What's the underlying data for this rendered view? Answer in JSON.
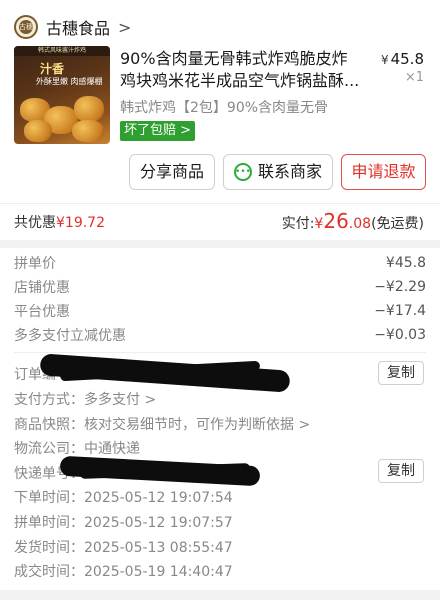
{
  "store": {
    "name": "古穗食品",
    "chevron": ">",
    "logo_text": "古穗"
  },
  "product": {
    "image_strip_text": "韩式风味酱汁炸鸡",
    "image_title": "汁香",
    "image_subtitle": "外酥里嫩 肉感爆棚",
    "title_line1": "90%含肉量无骨韩式炸鸡脆皮炸",
    "title_line2": "鸡块鸡米花半成品空气炸锅盐酥...",
    "price_symbol": "¥",
    "price": "45.8",
    "quantity": "×1",
    "spec": "韩式炸鸡【2包】90%含肉量无骨",
    "badge": "坏了包赔 >"
  },
  "actions": {
    "share": "分享商品",
    "contact": "联系商家",
    "refund": "申请退款"
  },
  "summary": {
    "discount_label": "共优惠",
    "discount_value": "¥19.72",
    "paid_label": "实付: ",
    "paid_symbol": "¥ ",
    "paid_int": "26",
    "paid_dec": ".08",
    "paid_note": " (免运费)"
  },
  "details": [
    {
      "label": "拼单价",
      "value": "¥45.8"
    },
    {
      "label": "店铺优惠",
      "value": "−¥2.29"
    },
    {
      "label": "平台优惠",
      "value": "−¥17.4"
    },
    {
      "label": "多多支付立减优惠",
      "value": "−¥0.03"
    }
  ],
  "order_info": {
    "order_no_label": "订单编号：",
    "copy_label": "复制",
    "payment_label": "支付方式：",
    "payment_value": "多多支付 >",
    "snapshot_label": "商品快照：",
    "snapshot_value": "核对交易细节时，可作为判断依据 >",
    "logistics_label": "物流公司：",
    "logistics_value": "中通快递",
    "tracking_label": "快递单号：",
    "order_time_label": "下单时间：",
    "order_time": "2025-05-12 19:07:54",
    "group_time_label": "拼单时间：",
    "group_time": "2025-05-12 19:07:57",
    "ship_time_label": "发货时间：",
    "ship_time": "2025-05-13 08:55:47",
    "deal_time_label": "成交时间：",
    "deal_time": "2025-05-19 14:40:47"
  },
  "colors": {
    "accent_red": "#e0302a",
    "badge_green": "#2f9f2f",
    "chat_green": "#2faa3c"
  },
  "icons": {
    "store_chevron": "chevron-right-icon",
    "chat": "chat-bubble-icon"
  }
}
